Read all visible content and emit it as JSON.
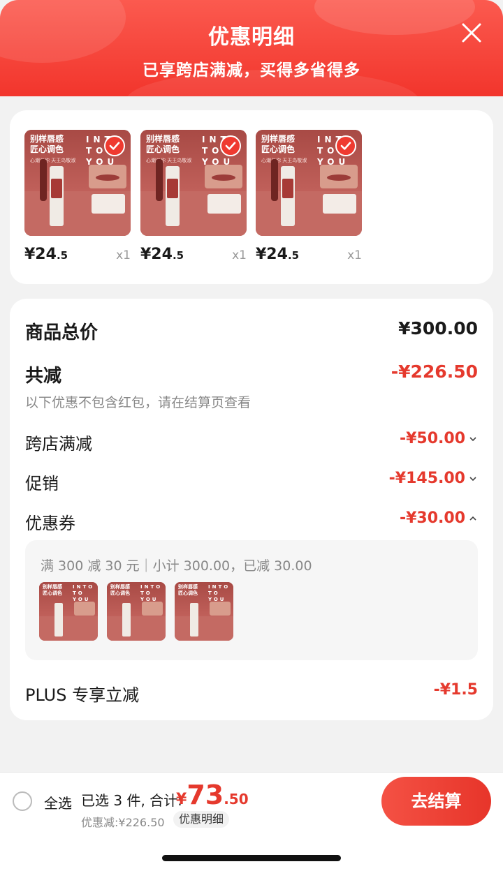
{
  "header": {
    "title": "优惠明细",
    "subtitle": "已享跨店满减，买得多省得多"
  },
  "products": [
    {
      "thumb_line1": "别样唇感",
      "thumb_line2": "匠心调色",
      "thumb_small": "心潮与你 天王鸟敬淑",
      "brand_line1": "INTO",
      "brand_line2": "TO YOU",
      "price_int": "¥24",
      "price_dec": ".5",
      "qty": "x1",
      "checked": true
    },
    {
      "thumb_line1": "别样唇感",
      "thumb_line2": "匠心调色",
      "thumb_small": "心潮与你 天王鸟敬淑",
      "brand_line1": "INTO",
      "brand_line2": "TO YOU",
      "price_int": "¥24",
      "price_dec": ".5",
      "qty": "x1",
      "checked": true
    },
    {
      "thumb_line1": "别样唇感",
      "thumb_line2": "匠心调色",
      "thumb_small": "心潮与你 天王鸟敬淑",
      "brand_line1": "INTO",
      "brand_line2": "TO YOU",
      "price_int": "¥24",
      "price_dec": ".5",
      "qty": "x1",
      "checked": true
    }
  ],
  "summary": {
    "goods_total_label": "商品总价",
    "goods_total_value": "¥300.00",
    "discount_label": "共减",
    "discount_value": "-¥226.50",
    "discount_note": "以下优惠不包含红包，请在结算页查看",
    "cross_store_label": "跨店满减",
    "cross_store_value": "-¥50.00",
    "promo_label": "促销",
    "promo_value": "-¥145.00",
    "coupon_label": "优惠券",
    "coupon_value": "-¥30.00",
    "coupon_detail": "满 300 减 30 元｜小计 300.00，已减 30.00",
    "plus_label": "PLUS 专享立减",
    "plus_value": "-¥1.5"
  },
  "coupon_items": [
    {
      "line1": "别样唇感",
      "line2": "匠心调色",
      "brand1": "INTO",
      "brand2": "TO YOU"
    },
    {
      "line1": "别样唇感",
      "line2": "匠心调色",
      "brand1": "INTO",
      "brand2": "TO YOU"
    },
    {
      "line1": "别样唇感",
      "line2": "匠心调色",
      "brand1": "INTO",
      "brand2": "TO YOU"
    }
  ],
  "bottom_bar": {
    "select_all": "全选",
    "selected_text": "已选 3 件, 合计:",
    "total_currency": "¥",
    "total_int": "73",
    "total_dec": ".50",
    "saved_text": "优惠减:¥226.50",
    "detail_link": "优惠明细",
    "checkout": "去结算"
  },
  "colors": {
    "accent": "#e5392d",
    "header_red": "#f2352c"
  },
  "icons": {
    "close": "close-icon",
    "check": "check-icon",
    "chevron_down": "chevron-down-icon",
    "chevron_up": "chevron-up-icon",
    "radio": "radio-unchecked-icon"
  }
}
